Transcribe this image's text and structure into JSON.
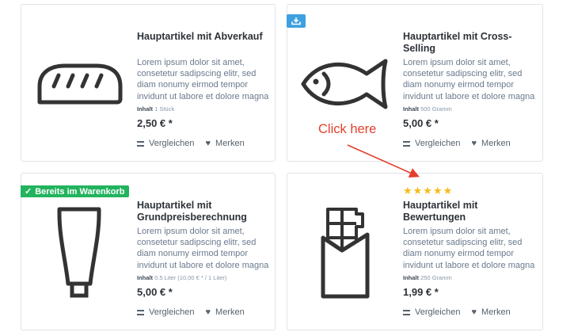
{
  "products": [
    {
      "title": "Hauptartikel mit Abverkauf",
      "description": "Lorem ipsum dolor sit amet, consetetur sadipscing elitr, sed diam nonumy eirmod tempor invidunt ut labore et dolore magna",
      "unit_label": "Inhalt",
      "unit_value": "1 Stück",
      "price": "2,50 € *",
      "icon": "bread-icon"
    },
    {
      "title": "Hauptartikel mit Cross-Selling",
      "description": "Lorem ipsum dolor sit amet, consetetur sadipscing elitr, sed diam nonumy eirmod tempor invidunt ut labore et dolore magna",
      "unit_label": "Inhalt",
      "unit_value": "500 Gramm",
      "price": "5,00 € *",
      "icon": "fish-icon"
    },
    {
      "title": "Hauptartikel mit Grundpreisberechnung",
      "description": "Lorem ipsum dolor sit amet, consetetur sadipscing elitr, sed diam nonumy eirmod tempor invidunt ut labore et dolore magna",
      "unit_label": "Inhalt",
      "unit_value": "0.5 Liter (10,00 € * / 1 Liter)",
      "price": "5,00 € *",
      "icon": "tube-icon"
    },
    {
      "title": "Hauptartikel mit Bewertungen",
      "description": "Lorem ipsum dolor sit amet, consetetur sadipscing elitr, sed diam nonumy eirmod tempor invidunt ut labore et dolore magna",
      "unit_label": "Inhalt",
      "unit_value": "250 Gramm",
      "price": "1,99 € *",
      "icon": "chocolate-icon",
      "rating_stars": "★★★★★"
    }
  ],
  "actions": {
    "compare": "Vergleichen",
    "wishlist": "Merken"
  },
  "badges": {
    "in_basket": "Bereits im Warenkorb",
    "download_icon": "download-icon"
  },
  "annotation": {
    "text": "Click here",
    "color": "#e53f2c"
  },
  "colors": {
    "badge_green": "#22b35e",
    "badge_blue": "#3ea0e0",
    "stars": "#f5bb1a"
  }
}
